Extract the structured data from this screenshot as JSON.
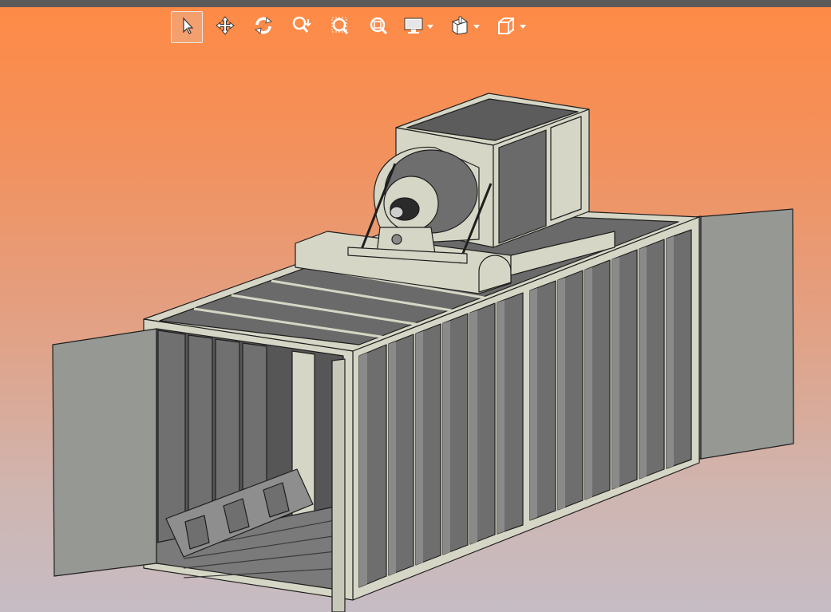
{
  "viewer": {
    "background_top": "#ff8a45",
    "background_bottom": "#c6bcc4"
  },
  "toolbar": {
    "tools": [
      {
        "name": "select",
        "icon": "pointer-icon",
        "active": true
      },
      {
        "name": "pan",
        "icon": "move-arrows-icon",
        "active": false
      },
      {
        "name": "rotate",
        "icon": "rotate-icon",
        "active": false
      },
      {
        "name": "zoom",
        "icon": "zoom-icon",
        "active": false
      },
      {
        "name": "zoom-window",
        "icon": "zoom-window-icon",
        "active": false
      },
      {
        "name": "zoom-fit",
        "icon": "zoom-fit-icon",
        "active": false
      }
    ],
    "dropdowns": [
      {
        "name": "display",
        "icon": "monitor-icon"
      },
      {
        "name": "section",
        "icon": "section-view-icon"
      },
      {
        "name": "view-orientation",
        "icon": "cube-view-icon"
      }
    ]
  },
  "model": {
    "description_colors": {
      "panel_dark": "#6b6b6b",
      "panel_mid": "#8d8d8d",
      "panel_light": "#9a9a96",
      "frame_cream": "#d4d4c4",
      "edge": "#222222"
    }
  }
}
